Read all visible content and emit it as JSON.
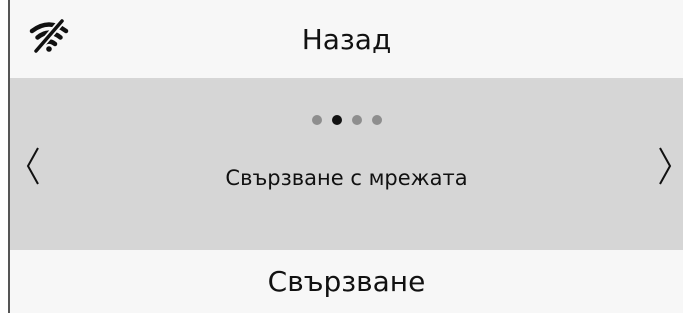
{
  "header": {
    "back_label": "Назад",
    "status_icon": "wifi-off-icon"
  },
  "carousel": {
    "slide_label": "Свързване с мрежата",
    "page_count": 4,
    "active_page": 2,
    "prev_icon": "chevron-left-icon",
    "next_icon": "chevron-right-icon"
  },
  "footer": {
    "connect_label": "Свързване"
  },
  "colors": {
    "carousel_bg": "#d6d6d6",
    "bar_bg": "#f7f7f7",
    "dot_active": "#111111",
    "dot_inactive": "#8e8e8e"
  }
}
